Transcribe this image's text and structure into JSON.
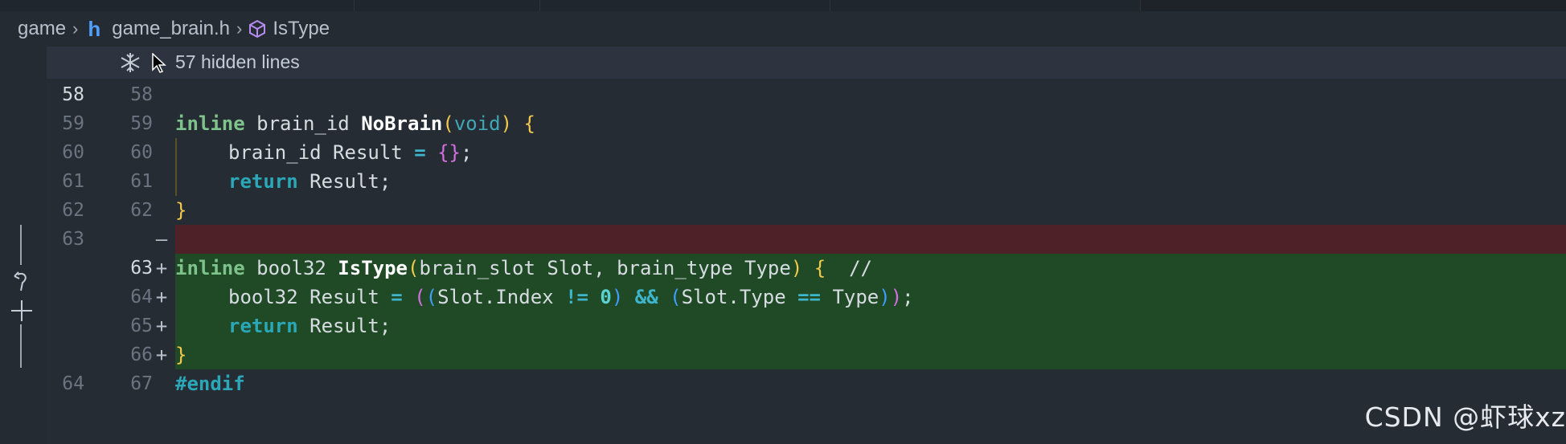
{
  "breadcrumb": {
    "folder": "game",
    "file": "game_brain.h",
    "file_icon": "h",
    "symbol": "IsType"
  },
  "hidden": {
    "label": "57 hidden lines"
  },
  "lines": [
    {
      "old": "58",
      "new": "58",
      "mark": "",
      "type": "ctx"
    },
    {
      "old": "59",
      "new": "59",
      "mark": "",
      "type": "ctx"
    },
    {
      "old": "60",
      "new": "60",
      "mark": "",
      "type": "ctx"
    },
    {
      "old": "61",
      "new": "61",
      "mark": "",
      "type": "ctx"
    },
    {
      "old": "62",
      "new": "62",
      "mark": "",
      "type": "ctx"
    },
    {
      "old": "63",
      "new": "",
      "mark": "—",
      "type": "del"
    },
    {
      "old": "",
      "new": "63",
      "mark": "+",
      "type": "add"
    },
    {
      "old": "",
      "new": "64",
      "mark": "+",
      "type": "add"
    },
    {
      "old": "",
      "new": "65",
      "mark": "+",
      "type": "add"
    },
    {
      "old": "",
      "new": "66",
      "mark": "+",
      "type": "add"
    },
    {
      "old": "64",
      "new": "67",
      "mark": "",
      "type": "ctx"
    }
  ],
  "code": {
    "l1": {
      "kw": "inline",
      "type": " brain_id ",
      "fn": "NoBrain",
      "p1": "(",
      "void": "void",
      "p2": ")",
      "brace": " {"
    },
    "l2": {
      "text": "brain_id Result ",
      "op": "=",
      "open": " {",
      "close": "}",
      "semi": ";"
    },
    "l3": {
      "ret": "return",
      "rest": " Result;"
    },
    "l4": {
      "brace": "}"
    },
    "l5": {
      "kw": "inline",
      "type": " bool32 ",
      "fn": "IsType",
      "p1": "(",
      "args": "brain_slot Slot, brain_type Type",
      "p2": ")",
      "brace": " {",
      "comment": "  //"
    },
    "l6": {
      "type": "bool32 Result ",
      "op": "=",
      "po1": " (",
      "po2": "(",
      "a": "Slot.Index ",
      "ne": "!=",
      "zero": " 0",
      "pc2": ")",
      "and": " &&",
      "po3": " (",
      "b": "Slot.Type ",
      "eq": "==",
      "c": " Type",
      "pc3": ")",
      "pc1": ")",
      "semi": ";"
    },
    "l7": {
      "ret": "return",
      "rest": " Result;"
    },
    "l8": {
      "brace": "}"
    },
    "l9": {
      "pp": "#endif"
    }
  },
  "watermark": "CSDN @虾球xz",
  "colors": {
    "deleted_bg": "#4d2127",
    "added_bg": "#1f4a25",
    "editor_bg": "#262c34"
  }
}
